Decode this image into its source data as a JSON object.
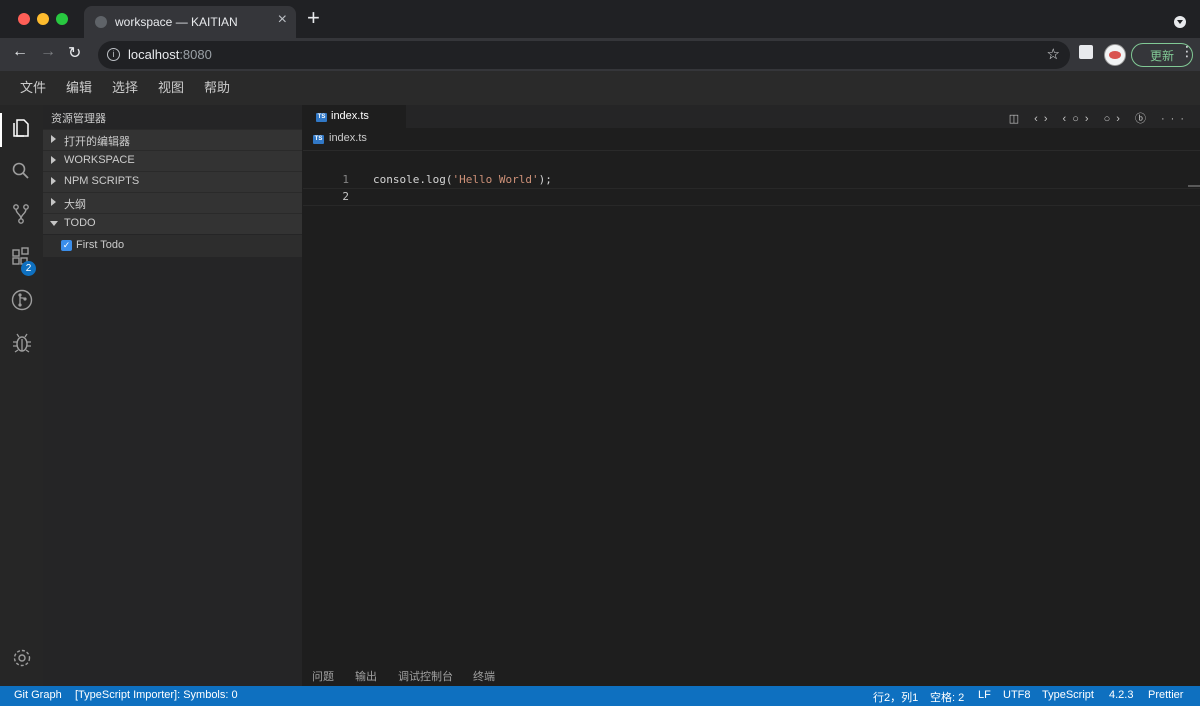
{
  "browser": {
    "tab_title": "workspace — KAITIAN",
    "tab_close": "×",
    "new_tab": "+",
    "url_host": "localhost",
    "url_port": ":8080",
    "update_label": "更新",
    "back_glyph": "←",
    "forward_glyph": "→",
    "reload_glyph": "↻",
    "star_glyph": "☆",
    "kebab_glyph": "⋮"
  },
  "menu": {
    "items": [
      {
        "label": "文件"
      },
      {
        "label": "编辑"
      },
      {
        "label": "选择"
      },
      {
        "label": "视图"
      },
      {
        "label": "帮助"
      }
    ]
  },
  "activity_bar": {
    "items": [
      {
        "icon": "files-icon"
      },
      {
        "icon": "search-icon"
      },
      {
        "icon": "source-control-icon"
      },
      {
        "icon": "extensions-icon",
        "badge": "2"
      },
      {
        "icon": "git-graph-icon"
      },
      {
        "icon": "debug-icon"
      }
    ],
    "settings_icon": "gear-icon"
  },
  "sidebar": {
    "title": "资源管理器",
    "sections": [
      {
        "label": "打开的编辑器",
        "expanded": false
      },
      {
        "label": "WORKSPACE",
        "expanded": false
      },
      {
        "label": "NPM SCRIPTS",
        "expanded": false
      },
      {
        "label": "大纲",
        "expanded": false
      },
      {
        "label": "TODO",
        "expanded": true
      }
    ],
    "todo_item": {
      "label": "First Todo",
      "checked": true,
      "check_glyph": "✓"
    }
  },
  "editor": {
    "tab_name": "index.ts",
    "ts_badge": "TS",
    "breadcrumb_file": "index.ts",
    "toolbar_icons": "◫ ‹› ‹○› ○› ⓑ ···",
    "lines": [
      {
        "num": "1",
        "code_pre": "console.log(",
        "code_str": "'Hello World'",
        "code_post": ");"
      },
      {
        "num": "2",
        "code_pre": "",
        "code_str": "",
        "code_post": ""
      }
    ]
  },
  "panel": {
    "tabs": [
      "问题",
      "输出",
      "调试控制台",
      "终端"
    ]
  },
  "status_bar": {
    "left": [
      "Git Graph",
      "[TypeScript Importer]: Symbols: 0"
    ],
    "right": [
      "行2，列1",
      "空格: 2",
      "LF",
      "UTF8",
      "TypeScript",
      "4.2.3",
      "Prettier"
    ]
  },
  "colors": {
    "status_bar": "#0e70c0",
    "update_button": "#81c995",
    "string": "#ce9178",
    "ts_badge": "#3178c6"
  }
}
